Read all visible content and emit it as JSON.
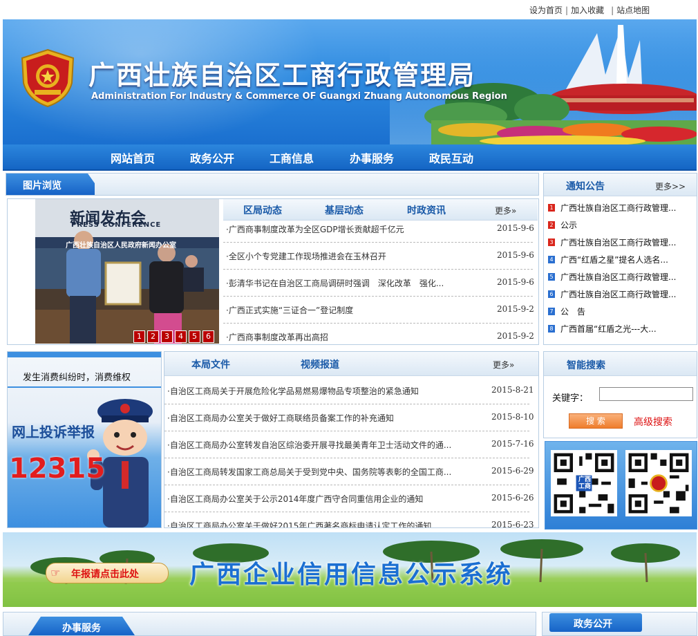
{
  "top_links": [
    "设为首页",
    "加入收藏",
    "站点地图"
  ],
  "header": {
    "title": "广西壮族自治区工商行政管理局",
    "subtitle": "Administration For Industry & Commerce OF Guangxi Zhuang Autonomous Region"
  },
  "nav": [
    "网站首页",
    "政务公开",
    "工商信息",
    "办事服务",
    "政民互动"
  ],
  "photo_browse": {
    "title": "图片浏览",
    "press_sign": "新闻发布会",
    "press_sign_en": "PRESS CONFERENCE",
    "backdrop_text": "广西壮族自治区人民政府新闻办公室",
    "pages": [
      "1",
      "2",
      "3",
      "4",
      "5",
      "6"
    ]
  },
  "news": {
    "tabs": [
      "区局动态",
      "基层动态",
      "时政资讯"
    ],
    "more": "更多»",
    "items": [
      {
        "title": "广西商事制度改革为全区GDP增长贡献超千亿元",
        "date": "2015-9-6"
      },
      {
        "title": "全区小个专党建工作现场推进会在玉林召开",
        "date": "2015-9-6"
      },
      {
        "title": "彭清华书记在自治区工商局调研时强调　深化改革　强化...",
        "date": "2015-9-6"
      },
      {
        "title": "广西正式实施“三证合一”登记制度",
        "date": "2015-9-2"
      },
      {
        "title": "广西商事制度改革再出高招",
        "date": "2015-9-2"
      }
    ]
  },
  "notices": {
    "title": "通知公告",
    "more": "更多>>",
    "items": [
      {
        "n": "1",
        "text": "广西壮族自治区工商行政管理...",
        "color": "#d9261c"
      },
      {
        "n": "2",
        "text": "公示",
        "color": "#d9261c"
      },
      {
        "n": "3",
        "text": "广西壮族自治区工商行政管理...",
        "color": "#d9261c"
      },
      {
        "n": "4",
        "text": "广西“红盾之星”提名人选名...",
        "color": "#2a6fd0"
      },
      {
        "n": "5",
        "text": "广西壮族自治区工商行政管理...",
        "color": "#2a6fd0"
      },
      {
        "n": "6",
        "text": "广西壮族自治区工商行政管理...",
        "color": "#2a6fd0"
      },
      {
        "n": "7",
        "text": "公　告",
        "color": "#2a6fd0"
      },
      {
        "n": "8",
        "text": "广西首届“红盾之光---大...",
        "color": "#2a6fd0"
      }
    ]
  },
  "complaint": {
    "caption": "发生消费纠纷时，消费维权",
    "label": "网上投诉举报",
    "hotline": "12315"
  },
  "docs": {
    "tabs": [
      "本局文件",
      "视频报道"
    ],
    "more": "更多»",
    "items": [
      {
        "title": "自治区工商局关于开展危险化学品易燃易爆物品专项整治的紧急通知",
        "date": "2015-8-21"
      },
      {
        "title": "自治区工商局办公室关于做好工商联络员备案工作的补充通知",
        "date": "2015-8-10"
      },
      {
        "title": "自治区工商局办公室转发自治区综治委开展寻找最美青年卫士活动文件的通...",
        "date": "2015-7-16"
      },
      {
        "title": "自治区工商局转发国家工商总局关于受到党中央、国务院等表彰的全国工商...",
        "date": "2015-6-29"
      },
      {
        "title": "自治区工商局办公室关于公示2014年度广西守合同重信用企业的通知",
        "date": "2015-6-26"
      },
      {
        "title": "自治区工商局办公室关于做好2015年广西著名商标申请认定工作的通知",
        "date": "2015-6-23"
      }
    ]
  },
  "search": {
    "title": "智能搜索",
    "keyword_label": "关键字：",
    "keyword_value": "",
    "button": "搜 索",
    "advanced": "高级搜索"
  },
  "qr": {
    "left_logo": "广西工商"
  },
  "credit_banner": {
    "annual_report": "年报请点击此处",
    "system_title": "广西企业信用信息公示系统"
  },
  "bottom": {
    "service_title": "办事服务",
    "affairs_title": "政务公开"
  }
}
